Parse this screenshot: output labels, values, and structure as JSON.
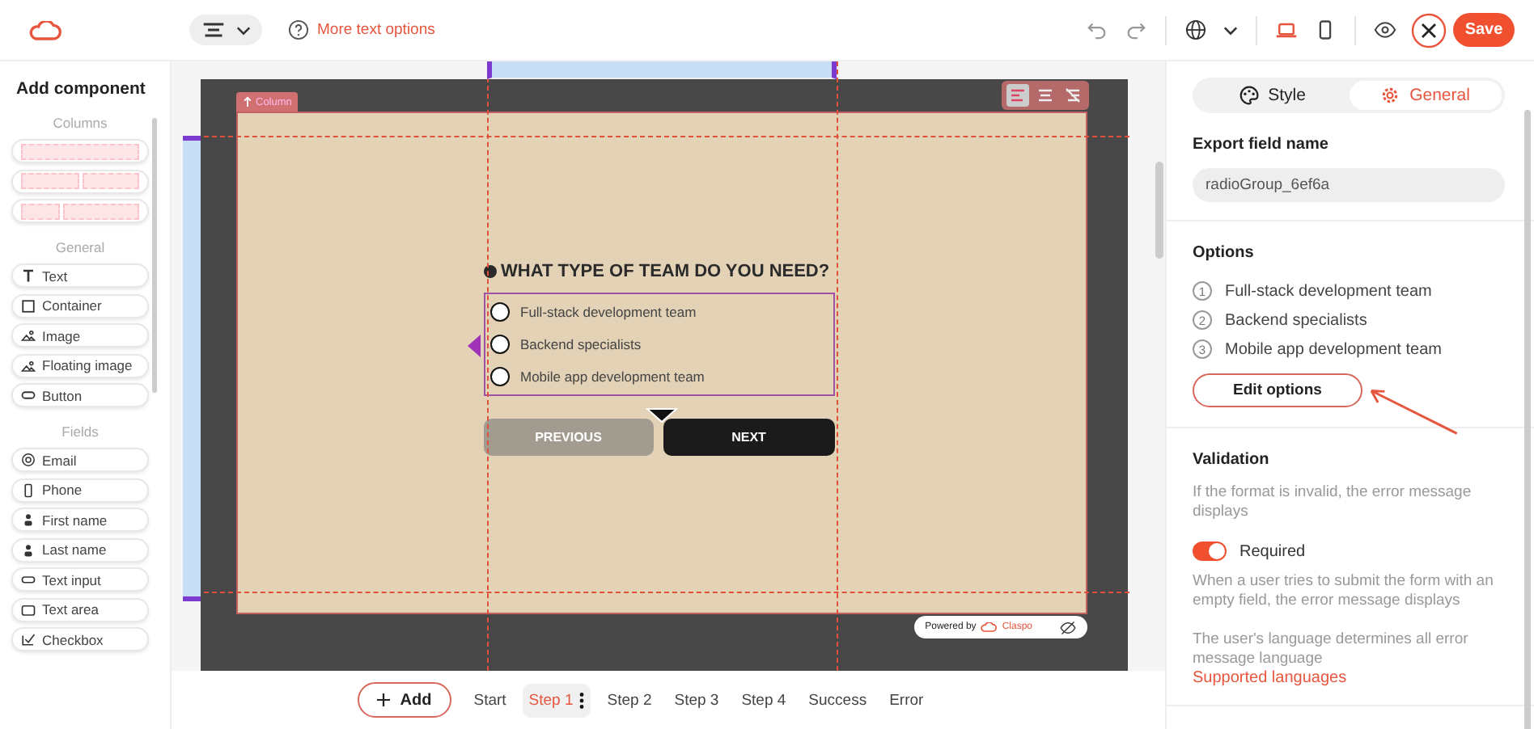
{
  "toolbar": {
    "help_label": "More text options",
    "devices": [
      {
        "kind": "laptop",
        "selected": true
      },
      {
        "kind": "phone",
        "selected": false
      }
    ],
    "save": "Save"
  },
  "sidebar": {
    "title": "Add component",
    "sections": [
      {
        "heading": "Columns",
        "items": [
          {
            "kind": "single"
          },
          {
            "kind": "halves"
          },
          {
            "kind": "thirds"
          }
        ]
      },
      {
        "heading": "General",
        "items": [
          {
            "kind": "text",
            "label": "Text"
          },
          {
            "kind": "container",
            "label": "Container"
          },
          {
            "kind": "image",
            "label": "Image"
          },
          {
            "kind": "floating",
            "label": "Floating image"
          },
          {
            "kind": "button",
            "label": "Button"
          }
        ]
      },
      {
        "heading": "Fields",
        "items": [
          {
            "kind": "email",
            "label": "Email"
          },
          {
            "kind": "phone",
            "label": "Phone"
          },
          {
            "kind": "person",
            "label": "First name"
          },
          {
            "kind": "person",
            "label": "Last name"
          },
          {
            "kind": "input",
            "label": "Text input"
          },
          {
            "kind": "area",
            "label": "Text area"
          },
          {
            "kind": "checkbox",
            "label": "Checkbox"
          }
        ]
      }
    ]
  },
  "canvas": {
    "column_tag": "Column",
    "question": "WHAT TYPE OF TEAM DO YOU NEED?",
    "options": [
      {
        "label": "Full-stack development team",
        "selected": false
      },
      {
        "label": "Backend specialists",
        "selected": false
      },
      {
        "label": "Mobile app development team",
        "selected": false
      }
    ],
    "buttons": [
      {
        "label": "PREVIOUS",
        "kind": "secondary"
      },
      {
        "label": "NEXT",
        "kind": "primary"
      }
    ],
    "powered_by": "Powered by",
    "brand": "Claspo"
  },
  "steps_bar": {
    "add": "Add",
    "steps": [
      {
        "label": "Start",
        "selected": false
      },
      {
        "label": "Step 1",
        "selected": true
      },
      {
        "label": "Step 2",
        "selected": false
      },
      {
        "label": "Step 3",
        "selected": false
      },
      {
        "label": "Step 4",
        "selected": false
      },
      {
        "label": "Success",
        "selected": false
      },
      {
        "label": "Error",
        "selected": false
      }
    ]
  },
  "panel": {
    "tabs": [
      {
        "label": "Style",
        "kind": "palette",
        "selected": false
      },
      {
        "label": "General",
        "kind": "gear",
        "selected": true
      }
    ],
    "export_field": {
      "label": "Export field name",
      "value": "radioGroup_6ef6a"
    },
    "options": {
      "heading": "Options",
      "items": [
        {
          "number": "1",
          "label": "Full-stack development team"
        },
        {
          "number": "2",
          "label": "Backend specialists"
        },
        {
          "number": "3",
          "label": "Mobile app development team"
        }
      ],
      "button": "Edit options"
    },
    "validation": {
      "heading": "Validation",
      "description": "If the format is invalid, the error message displays",
      "toggle": {
        "label": "Required",
        "on": true
      },
      "toggle_note": "When a user tries to submit the form with an empty field, the error message displays",
      "language_note": "The user's language determines all error message language",
      "link": "Supported languages"
    }
  }
}
